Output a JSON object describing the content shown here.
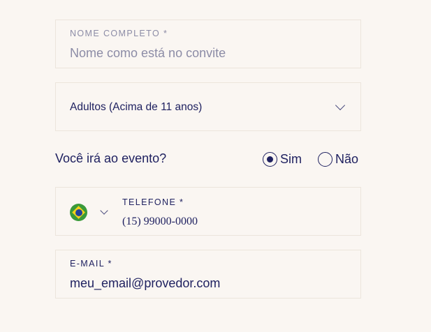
{
  "form": {
    "name": {
      "label": "NOME COMPLETO *",
      "placeholder": "Nome como está no convite"
    },
    "age_group": {
      "selected": "Adultos (Acima de 11 anos)"
    },
    "attendance": {
      "question": "Você irá ao evento?",
      "options": [
        {
          "label": "Sim",
          "checked": true
        },
        {
          "label": "Não",
          "checked": false
        }
      ]
    },
    "phone": {
      "label": "TELEFONE *",
      "value": "(15) 99000-0000",
      "country_icon": "brazil-flag-icon"
    },
    "email": {
      "label": "E-MAIL *",
      "value": "meu_email@provedor.com"
    }
  },
  "colors": {
    "background": "#faf6f2",
    "text": "#1f2160",
    "placeholder": "#8c8ca6",
    "border": "#ece5dc"
  }
}
